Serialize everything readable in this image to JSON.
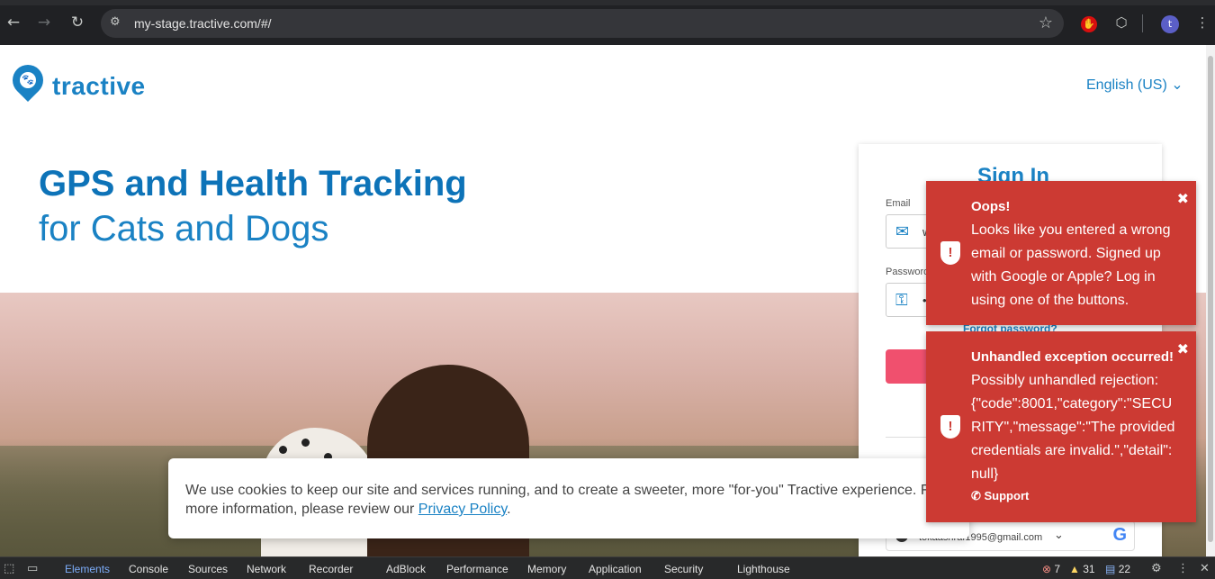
{
  "browser": {
    "url": "my-stage.tractive.com/#/",
    "avatar_letter": "t",
    "back_icon": "←",
    "forward_icon": "→",
    "reload_icon": "↻",
    "site_info_icon": "⚙",
    "bookmark_icon": "☆",
    "extension_icon": "⬡",
    "menu_icon": "⋮"
  },
  "header": {
    "logo_text": "tractive",
    "language": "English (US) ⌄"
  },
  "hero": {
    "headline": "GPS and Health Tracking",
    "subline": "for Cats and Dogs"
  },
  "signin": {
    "title": "Sign In",
    "email_label": "Email",
    "email_value": "w",
    "password_label": "Password",
    "password_value": "•",
    "forgot_link": "Forgot password?",
    "google_email": "tokaashraf1995@gmail.com",
    "google_letter": "G"
  },
  "cookie": {
    "text_before": "We use cookies to keep our site and services running, and to create a sweeter, more \"for-you\" Tractive experience. For more information, please review our ",
    "link_text": "Privacy Policy",
    "text_after": "."
  },
  "toasts": [
    {
      "title": "Oops!",
      "message": "Looks like you entered a wrong email or password. Signed up with Google or Apple? Log in using one of the buttons."
    },
    {
      "title": "Unhandled exception occurred!",
      "message": "Possibly unhandled rejection: {\"code\":8001,\"category\":\"SECURITY\",\"message\":\"The provided credentials are invalid.\",\"detail\":null}",
      "support": "✆ Support"
    }
  ],
  "devtools": {
    "tabs": [
      "Elements",
      "Console",
      "Sources",
      "Network",
      "Recorder",
      "AdBlock",
      "Performance",
      "Memory",
      "Application",
      "Security",
      "Lighthouse"
    ],
    "errors": "7",
    "warnings": "31",
    "messages": "22"
  },
  "colors": {
    "brand": "#1a82c4",
    "toast": "#cc3a33",
    "signin_button": "#f0506e"
  }
}
